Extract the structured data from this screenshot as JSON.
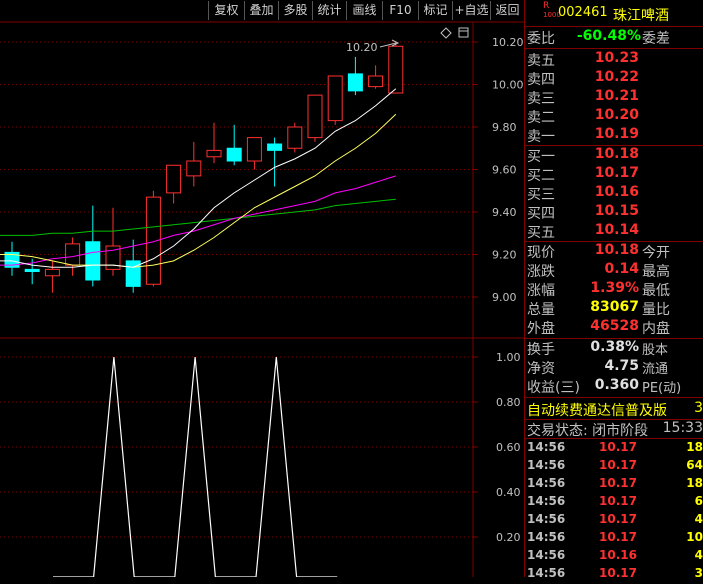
{
  "toolbar": {
    "buttons": [
      "复权",
      "叠加",
      "多股",
      "统计",
      "画线",
      "F10",
      "标记",
      "+自选",
      "返回"
    ]
  },
  "stock": {
    "badge_top": "R",
    "badge_bottom": "1000",
    "code": "002461",
    "name": "珠江啤酒"
  },
  "chart": {
    "price_axis": [
      "10.20",
      "10.00",
      "9.80",
      "9.60",
      "9.40",
      "9.20",
      "9.00"
    ],
    "peak_label": "10.20",
    "indicator_axis": [
      "1.00",
      "0.80",
      "0.60",
      "0.40",
      "0.20"
    ]
  },
  "chart_data": {
    "type": "candlestick",
    "candles": [
      {
        "o": 9.21,
        "c": 9.14,
        "h": 9.26,
        "l": 9.1
      },
      {
        "o": 9.13,
        "c": 9.12,
        "h": 9.18,
        "l": 9.06
      },
      {
        "o": 9.1,
        "c": 9.13,
        "h": 9.17,
        "l": 9.02
      },
      {
        "o": 9.15,
        "c": 9.25,
        "h": 9.28,
        "l": 9.1
      },
      {
        "o": 9.26,
        "c": 9.08,
        "h": 9.43,
        "l": 9.05
      },
      {
        "o": 9.13,
        "c": 9.24,
        "h": 9.42,
        "l": 9.1
      },
      {
        "o": 9.17,
        "c": 9.05,
        "h": 9.27,
        "l": 9.02
      },
      {
        "o": 9.06,
        "c": 9.47,
        "h": 9.5,
        "l": 9.05
      },
      {
        "o": 9.49,
        "c": 9.62,
        "h": 9.62,
        "l": 9.44
      },
      {
        "o": 9.57,
        "c": 9.64,
        "h": 9.73,
        "l": 9.52
      },
      {
        "o": 9.66,
        "c": 9.69,
        "h": 9.82,
        "l": 9.63
      },
      {
        "o": 9.7,
        "c": 9.64,
        "h": 9.81,
        "l": 9.62
      },
      {
        "o": 9.64,
        "c": 9.75,
        "h": 9.75,
        "l": 9.6
      },
      {
        "o": 9.72,
        "c": 9.69,
        "h": 9.75,
        "l": 9.52
      },
      {
        "o": 9.7,
        "c": 9.8,
        "h": 9.82,
        "l": 9.68
      },
      {
        "o": 9.75,
        "c": 9.95,
        "h": 9.95,
        "l": 9.73
      },
      {
        "o": 9.83,
        "c": 10.04,
        "h": 10.04,
        "l": 9.81
      },
      {
        "o": 10.05,
        "c": 9.97,
        "h": 10.13,
        "l": 9.95
      },
      {
        "o": 9.99,
        "c": 10.04,
        "h": 10.09,
        "l": 9.98
      },
      {
        "o": 9.96,
        "c": 10.18,
        "h": 10.2,
        "l": 9.96
      }
    ],
    "ma_white": [
      9.17,
      9.15,
      9.14,
      9.14,
      9.15,
      9.15,
      9.14,
      9.18,
      9.24,
      9.32,
      9.42,
      9.49,
      9.55,
      9.61,
      9.65,
      9.7,
      9.78,
      9.83,
      9.9,
      9.98
    ],
    "ma_yellow": [
      9.2,
      9.19,
      9.17,
      9.15,
      9.15,
      9.15,
      9.14,
      9.15,
      9.17,
      9.22,
      9.28,
      9.35,
      9.42,
      9.47,
      9.52,
      9.57,
      9.64,
      9.7,
      9.77,
      9.86
    ],
    "ma_magenta": [
      9.15,
      9.16,
      9.18,
      9.19,
      9.21,
      9.22,
      9.24,
      9.26,
      9.29,
      9.31,
      9.34,
      9.37,
      9.39,
      9.41,
      9.43,
      9.45,
      9.49,
      9.51,
      9.54,
      9.57
    ],
    "ma_green": [
      9.29,
      9.29,
      9.3,
      9.3,
      9.31,
      9.31,
      9.32,
      9.33,
      9.34,
      9.35,
      9.36,
      9.37,
      9.38,
      9.39,
      9.4,
      9.41,
      9.43,
      9.44,
      9.45,
      9.46
    ],
    "indicator": [
      0,
      0,
      0,
      1,
      0,
      0,
      0,
      1,
      0,
      0,
      0,
      1,
      0,
      0,
      0
    ]
  },
  "quote": {
    "weibi_label": "委比",
    "weibi_value": "-60.48%",
    "weicha_label": "委差",
    "sells": [
      {
        "label": "卖五",
        "price": "10.23"
      },
      {
        "label": "卖四",
        "price": "10.22"
      },
      {
        "label": "卖三",
        "price": "10.21"
      },
      {
        "label": "卖二",
        "price": "10.20"
      },
      {
        "label": "卖一",
        "price": "10.19"
      }
    ],
    "buys": [
      {
        "label": "买一",
        "price": "10.18"
      },
      {
        "label": "买二",
        "price": "10.17"
      },
      {
        "label": "买三",
        "price": "10.16"
      },
      {
        "label": "买四",
        "price": "10.15"
      },
      {
        "label": "买五",
        "price": "10.14"
      }
    ],
    "stats": [
      {
        "label": "现价",
        "value": "10.18",
        "label2": "今开",
        "color": "#ff3030"
      },
      {
        "label": "涨跌",
        "value": "0.14",
        "label2": "最高",
        "color": "#ff3030"
      },
      {
        "label": "涨幅",
        "value": "1.39%",
        "label2": "最低",
        "color": "#ff3030"
      },
      {
        "label": "总量",
        "value": "83067",
        "label2": "量比",
        "color": "#ffff00"
      },
      {
        "label": "外盘",
        "value": "46528",
        "label2": "内盘",
        "color": "#ff3030"
      }
    ],
    "stats2": [
      {
        "label": "换手",
        "value": "0.38%",
        "label2": "股本"
      },
      {
        "label": "净资",
        "value": "4.75",
        "label2": "流通"
      },
      {
        "label": "收益(三)",
        "value": "0.360",
        "label2": "PE(动)"
      }
    ],
    "ticker": "自动续费通达信普及版",
    "ticker_tail": "3",
    "trade_status": "交易状态: 闭市阶段",
    "trade_time": "15:33"
  },
  "ticks": [
    {
      "time": "14:56",
      "price": "10.17",
      "vol": "18"
    },
    {
      "time": "14:56",
      "price": "10.17",
      "vol": "64"
    },
    {
      "time": "14:56",
      "price": "10.17",
      "vol": "18"
    },
    {
      "time": "14:56",
      "price": "10.17",
      "vol": "6"
    },
    {
      "time": "14:56",
      "price": "10.17",
      "vol": "4"
    },
    {
      "time": "14:56",
      "price": "10.17",
      "vol": "10"
    },
    {
      "time": "14:56",
      "price": "10.16",
      "vol": "4"
    },
    {
      "time": "14:56",
      "price": "10.17",
      "vol": "3"
    }
  ],
  "colors": {
    "up": "#ff3030",
    "down": "#00ffff",
    "grid": "#800000",
    "axis": "#c0c0c0"
  }
}
